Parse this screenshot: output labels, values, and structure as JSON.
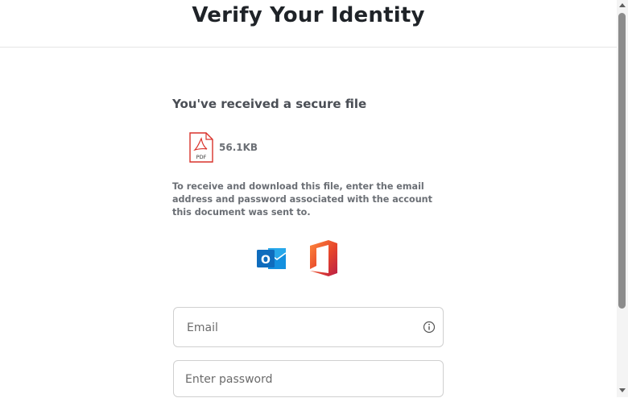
{
  "header": {
    "title": "Verify Your Identity"
  },
  "card": {
    "heading": "You've received a secure file",
    "file": {
      "icon": "pdf-file-icon",
      "badge": "PDF",
      "size": "56.1KB"
    },
    "instructions": "To receive and download this file, enter the email address and password associated with the account this document was sent to.",
    "providers": [
      {
        "icon": "outlook-icon",
        "letter": "O"
      },
      {
        "icon": "office-icon"
      }
    ]
  },
  "form": {
    "email": {
      "placeholder": "Email",
      "value": "",
      "icon": "info-icon"
    },
    "password": {
      "placeholder": "Enter password",
      "value": ""
    }
  },
  "colors": {
    "title": "#1f2328",
    "text_muted": "#6b6f75",
    "pdf_red": "#d9322b",
    "outlook_blue": "#0f6cbd",
    "office_orange": "#e6452b",
    "office_red": "#b91e46",
    "border": "#d0d0d0"
  }
}
